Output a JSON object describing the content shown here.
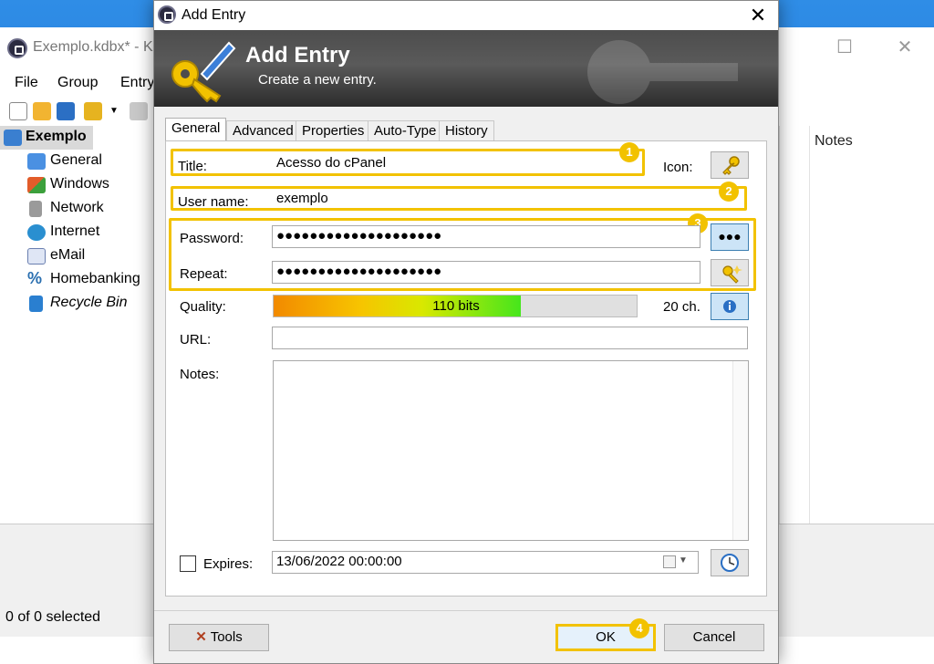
{
  "main_window": {
    "title": "Exemplo.kdbx* - K",
    "menu": [
      "File",
      "Group",
      "Entry"
    ],
    "tree": [
      {
        "label": "Exemplo",
        "icon": "folder-open-icon",
        "color": "#3a7fd0"
      },
      {
        "label": "General",
        "icon": "folder-icon",
        "color": "#4a90e2"
      },
      {
        "label": "Windows",
        "icon": "windows-icon",
        "color": "#e25c2a"
      },
      {
        "label": "Network",
        "icon": "network-icon",
        "color": "#8a8a8a"
      },
      {
        "label": "Internet",
        "icon": "globe-icon",
        "color": "#2a8fd0"
      },
      {
        "label": "eMail",
        "icon": "envelope-icon",
        "color": "#6a7fb0"
      },
      {
        "label": "Homebanking",
        "icon": "percent-icon",
        "color": "#2a6fb0"
      },
      {
        "label": "Recycle Bin",
        "icon": "recycle-bin-icon",
        "color": "#2a7fd0"
      }
    ],
    "notes_header": "Notes",
    "status": "0 of 0 selected"
  },
  "dialog": {
    "title": "Add Entry",
    "banner_title": "Add Entry",
    "banner_subtitle": "Create a new entry.",
    "tabs": [
      "General",
      "Advanced",
      "Properties",
      "Auto-Type",
      "History"
    ],
    "labels": {
      "title": "Title:",
      "icon": "Icon:",
      "username": "User name:",
      "password": "Password:",
      "repeat": "Repeat:",
      "quality": "Quality:",
      "url": "URL:",
      "notes": "Notes:",
      "expires": "Expires:"
    },
    "values": {
      "title": "Acesso do cPanel",
      "username": "exemplo",
      "password": "●●●●●●●●●●●●●●●●●●●●",
      "repeat": "●●●●●●●●●●●●●●●●●●●●",
      "quality_text": "110 bits",
      "quality_fraction": 0.68,
      "char_count": "20 ch.",
      "url": "",
      "notes": "",
      "expires": "13/06/2022 00:00:00",
      "expires_checked": false
    },
    "show_password_label": "●●●",
    "buttons": {
      "tools": "Tools",
      "ok": "OK",
      "cancel": "Cancel"
    },
    "badges": [
      "1",
      "2",
      "3",
      "4"
    ],
    "highlight_color": "#f2c200"
  }
}
